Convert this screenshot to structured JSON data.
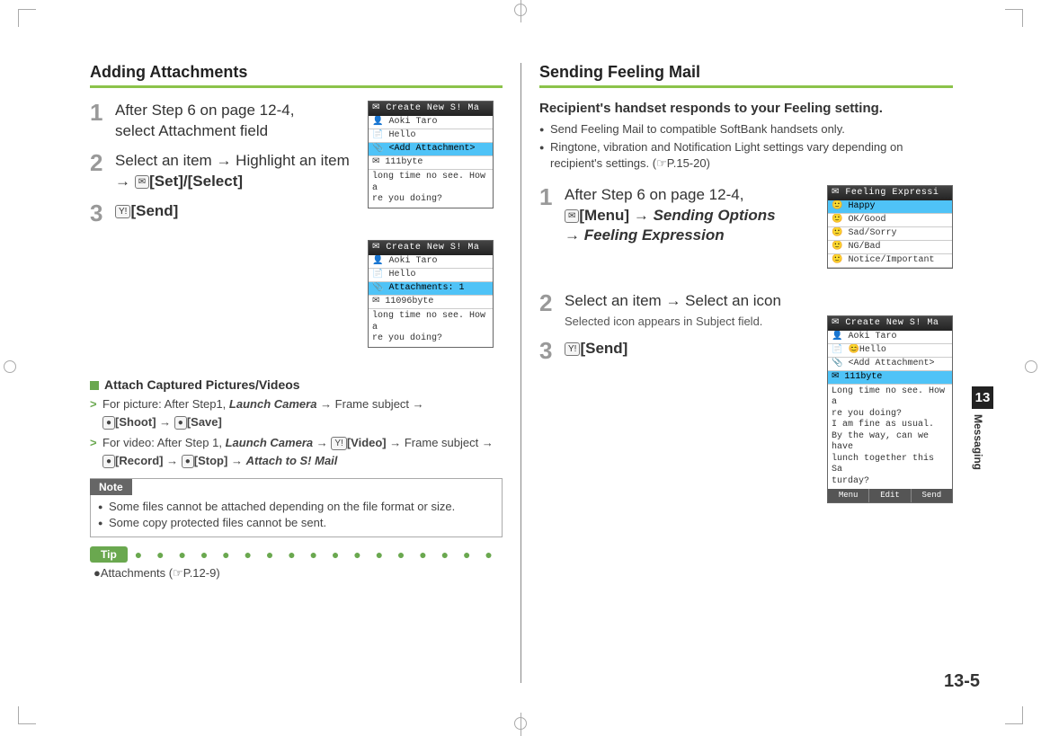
{
  "page_number": "13-5",
  "side_tab": {
    "chapter": "13",
    "label": "Messaging"
  },
  "left": {
    "title": "Adding Attachments",
    "steps": [
      {
        "num": "1",
        "text_pre": "After Step 6 on page 12-4,",
        "text_line2": "select Attachment field"
      },
      {
        "num": "2",
        "text_pre": "Select an item ",
        "arrow1": "→",
        "text_mid": " Highlight an item",
        "line2_arrow": "→ ",
        "btn_icon": "✉",
        "btn_label": "[Set]/[Select]"
      },
      {
        "num": "3",
        "btn_icon": "Y!",
        "btn_label": "[Send]"
      }
    ],
    "sub_heading": "Attach Captured Pictures/Videos",
    "chev": [
      {
        "pre": "For picture: After Step1, ",
        "bi1": "Launch Camera",
        "mid1": " → Frame subject → ",
        "btn1_icon": "●",
        "btn1_label": "[Shoot]",
        "mid2": " → ",
        "btn2_icon": "●",
        "btn2_label": "[Save]"
      },
      {
        "pre": "For video: After Step 1, ",
        "bi1": "Launch Camera",
        "mid1": " → ",
        "btnA_icon": "Y!",
        "btnA_label": "[Video]",
        "mid2": " → Frame subject → ",
        "btnB_icon": "●",
        "btnB_label": "[Record]",
        "mid3": " → ",
        "btnC_icon": "●",
        "btnC_label": "[Stop]",
        "mid4": " → ",
        "bi2": "Attach to S! Mail"
      }
    ],
    "note": {
      "label": "Note",
      "items": [
        "Some files cannot be attached depending on the file format or size.",
        "Some copy protected files cannot be sent."
      ]
    },
    "tip": {
      "label": "Tip",
      "ref": "●Attachments (☞P.12-9)"
    },
    "ss1": {
      "title": "✉ Create New S! Ma",
      "rows": [
        "👤 Aoki Taro",
        "📄 Hello",
        "📎 <Add Attachment>",
        "✉ 111byte"
      ],
      "body": "long time no see. How a\nre you doing?"
    },
    "ss2": {
      "title": "✉ Create New S! Ma",
      "rows": [
        "👤 Aoki Taro",
        "📄 Hello",
        "📎 Attachments: 1",
        "✉ 11096byte"
      ],
      "body": "long time no see. How a\nre you doing?"
    }
  },
  "right": {
    "title": "Sending Feeling Mail",
    "intro_bold": "Recipient's handset responds to your Feeling setting.",
    "bullets": [
      "Send Feeling Mail to compatible SoftBank handsets only.",
      "Ringtone, vibration and Notification Light settings vary depending on recipient's settings. (☞P.15-20)"
    ],
    "steps": [
      {
        "num": "1",
        "line1_pre": "After Step 6 on page 12-4,",
        "line2_icon": "✉",
        "line2_btn": "[Menu]",
        "line2_arrow": " → ",
        "line2_bi": "Sending Options",
        "line3_arrow": "→ ",
        "line3_bi": "Feeling Expression"
      },
      {
        "num": "2",
        "line1": "Select an item → Select an icon",
        "sub": "Selected icon appears in Subject field."
      },
      {
        "num": "3",
        "btn_icon": "Y!",
        "btn_label": "[Send]"
      }
    ],
    "ss3": {
      "title": "✉ Feeling Expressi",
      "rows": [
        "🙂 Happy",
        "🙂 OK/Good",
        "🙂 Sad/Sorry",
        "🙂 NG/Bad",
        "🙂 Notice/Important"
      ]
    },
    "ss4": {
      "title": "✉ Create New S! Ma",
      "rows": [
        "👤 Aoki Taro",
        "📄 😊Hello",
        "📎 <Add Attachment>",
        "✉ 111byte"
      ],
      "body": "Long time no see. How a\nre you doing?\nI am fine as usual.\nBy the way, can we have\n lunch together this Sa\nturday?",
      "soft": [
        "Menu",
        "Edit",
        "Send"
      ]
    }
  }
}
